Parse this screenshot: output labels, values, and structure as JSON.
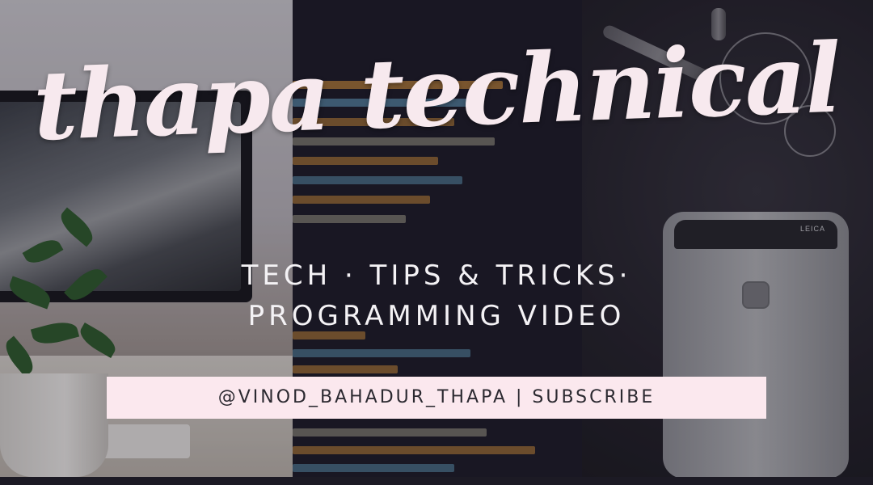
{
  "title": "thapa technical",
  "tagline": {
    "line1": "TECH · TIPS & TRICKS·",
    "line2": "PROGRAMMING VIDEO"
  },
  "handle_bar": {
    "text": "@VINOD_BAHADUR_THAPA | SUBSCRIBE"
  },
  "phone": {
    "brand": "LEICA"
  },
  "colors": {
    "title": "#f7e9ee",
    "handle_bar_bg": "#fbe8ee",
    "handle_text": "#2b2930",
    "code_bg": "#1b1a26"
  }
}
